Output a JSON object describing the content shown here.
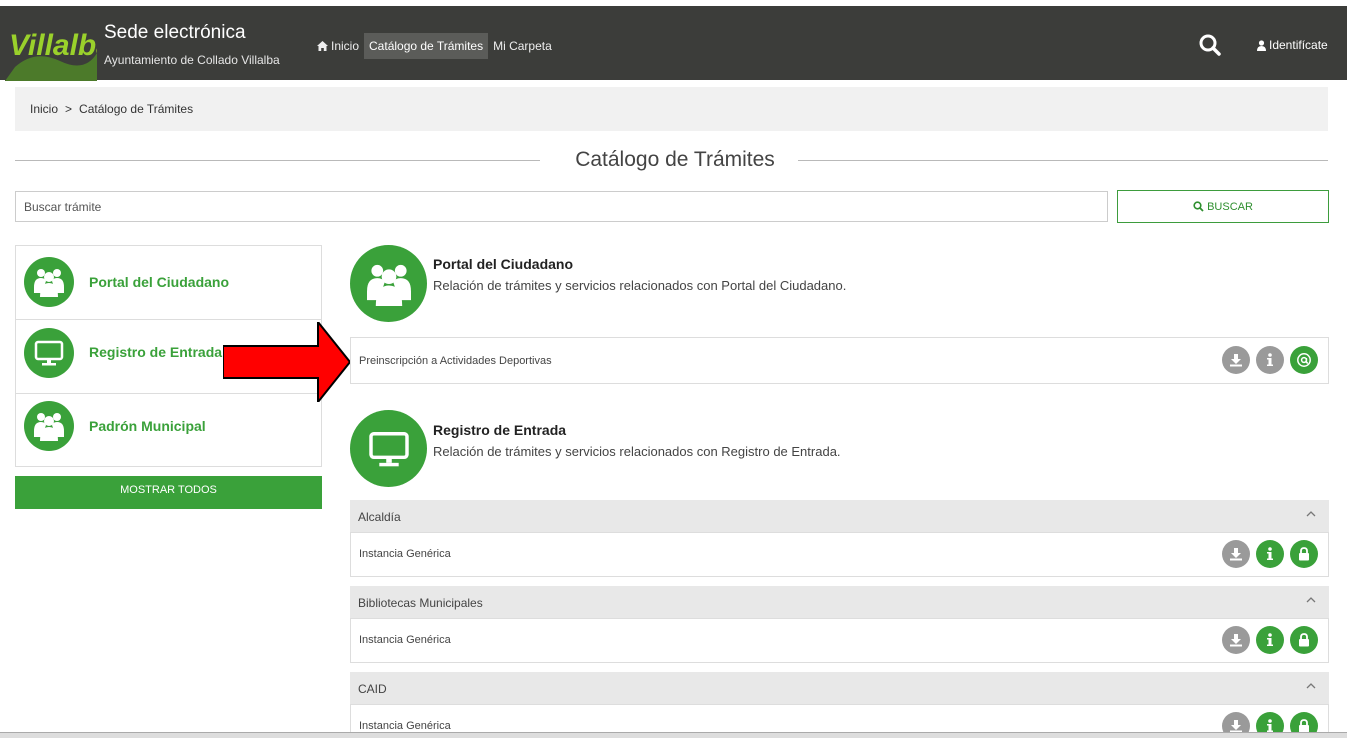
{
  "header": {
    "logo_text": "Villalba",
    "title": "Sede electrónica",
    "subtitle": "Ayuntamiento de Collado Villalba",
    "nav": [
      {
        "label": "Inicio"
      },
      {
        "label": "Catálogo de Trámites"
      },
      {
        "label": "Mi Carpeta"
      }
    ],
    "login_label": "Identifícate"
  },
  "breadcrumb": {
    "items": [
      "Inicio",
      "Catálogo de Trámites"
    ],
    "separator": ">"
  },
  "page_title": "Catálogo de Trámites",
  "search": {
    "placeholder": "Buscar trámite",
    "button_label": "BUSCAR"
  },
  "sidebar": {
    "items": [
      {
        "label": "Portal del Ciudadano",
        "icon": "people-icon"
      },
      {
        "label": "Registro de Entrada",
        "icon": "monitor-icon"
      },
      {
        "label": "Padrón Municipal",
        "icon": "people-icon"
      }
    ],
    "show_all_label": "MOSTRAR TODOS"
  },
  "sections": [
    {
      "title": "Portal del Ciudadano",
      "description": "Relación de trámites y servicios relacionados con Portal del Ciudadano.",
      "rows": [
        {
          "label": "Preinscripción a Actividades Deportivas",
          "icons": [
            "download-icon",
            "info-icon",
            "at-icon"
          ]
        }
      ]
    },
    {
      "title": "Registro de Entrada",
      "description": "Relación de trámites y servicios relacionados con Registro de Entrada.",
      "groups": [
        {
          "label": "Alcaldía",
          "rows": [
            {
              "label": "Instancia Genérica"
            }
          ]
        },
        {
          "label": "Bibliotecas Municipales",
          "rows": [
            {
              "label": "Instancia Genérica"
            }
          ]
        },
        {
          "label": "CAID",
          "rows": [
            {
              "label": "Instancia Genérica"
            }
          ]
        }
      ]
    }
  ],
  "colors": {
    "navbar": "#3c3d3a",
    "accent_green": "#3aa13a",
    "icon_grey": "#9a9a9a",
    "arrow_red": "#ff0000"
  }
}
